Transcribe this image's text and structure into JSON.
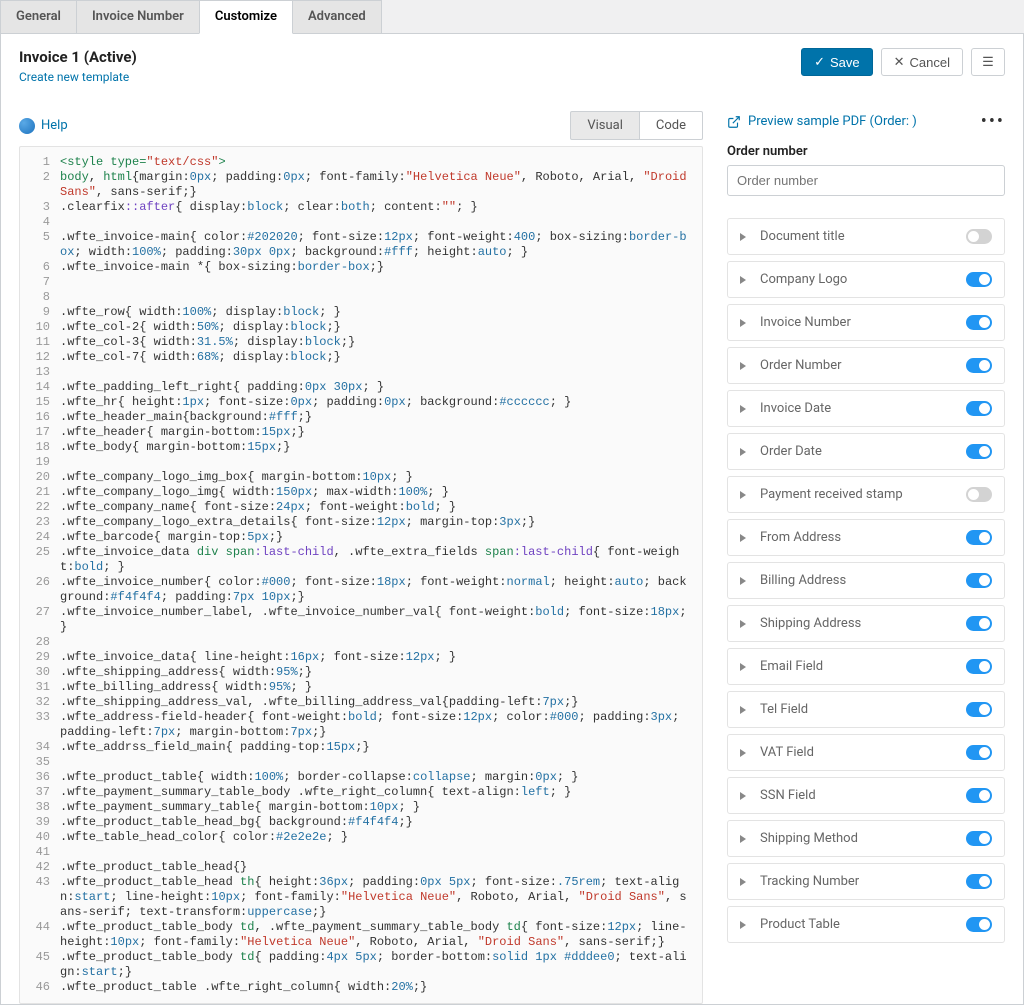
{
  "tabs": {
    "general": "General",
    "invoice_number": "Invoice Number",
    "customize": "Customize",
    "advanced": "Advanced"
  },
  "header": {
    "title": "Invoice 1 (Active)",
    "new_template": "Create new template",
    "save": "Save",
    "cancel": "Cancel"
  },
  "leftbar": {
    "help": "Help",
    "visual": "Visual",
    "code": "Code"
  },
  "preview": {
    "link": "Preview sample PDF (Order: )",
    "order_label": "Order number",
    "order_placeholder": "Order number"
  },
  "accordion": [
    {
      "label": "Document title",
      "on": false
    },
    {
      "label": "Company Logo",
      "on": true
    },
    {
      "label": "Invoice Number",
      "on": true
    },
    {
      "label": "Order Number",
      "on": true
    },
    {
      "label": "Invoice Date",
      "on": true
    },
    {
      "label": "Order Date",
      "on": true
    },
    {
      "label": "Payment received stamp",
      "on": false
    },
    {
      "label": "From Address",
      "on": true
    },
    {
      "label": "Billing Address",
      "on": true
    },
    {
      "label": "Shipping Address",
      "on": true
    },
    {
      "label": "Email Field",
      "on": true
    },
    {
      "label": "Tel Field",
      "on": true
    },
    {
      "label": "VAT Field",
      "on": true
    },
    {
      "label": "SSN Field",
      "on": true
    },
    {
      "label": "Shipping Method",
      "on": true
    },
    {
      "label": "Tracking Number",
      "on": true
    },
    {
      "label": "Product Table",
      "on": true
    }
  ],
  "code_lines": [
    {
      "n": 1,
      "h": "<span class='t-green'>&lt;style type=</span><span class='t-red'>\"text/css\"</span><span class='t-green'>&gt;</span>"
    },
    {
      "n": 2,
      "h": "<span class='t-green'>body</span>, <span class='t-green'>html</span>{margin:<span class='t-blue'>0px</span>; padding:<span class='t-blue'>0px</span>; font-family:<span class='t-red'>\"Helvetica Neue\"</span>, Roboto, Arial, <span class='t-red'>\"Droid Sans\"</span>, sans-serif;}"
    },
    {
      "n": 3,
      "h": ".clearfix<span class='t-purple'>::after</span>{ display:<span class='t-blue'>block</span>; clear:<span class='t-blue'>both</span>; content:<span class='t-red'>\"\"</span>; }"
    },
    {
      "n": 4,
      "h": ""
    },
    {
      "n": 5,
      "h": ".wfte_invoice-main{ color:<span class='t-blue'>#202020</span>; font-size:<span class='t-blue'>12px</span>; font-weight:<span class='t-blue'>400</span>; box-sizing:<span class='t-blue'>border-box</span>; width:<span class='t-blue'>100%</span>; padding:<span class='t-blue'>30px 0px</span>; background:<span class='t-blue'>#fff</span>; height:<span class='t-blue'>auto</span>; }"
    },
    {
      "n": 6,
      "h": ".wfte_invoice-main *{ box-sizing:<span class='t-blue'>border-box</span>;}"
    },
    {
      "n": 7,
      "h": ""
    },
    {
      "n": 8,
      "h": ""
    },
    {
      "n": 9,
      "h": ".wfte_row{ width:<span class='t-blue'>100%</span>; display:<span class='t-blue'>block</span>; }"
    },
    {
      "n": 10,
      "h": ".wfte_col-2{ width:<span class='t-blue'>50%</span>; display:<span class='t-blue'>block</span>;}"
    },
    {
      "n": 11,
      "h": ".wfte_col-3{ width:<span class='t-blue'>31.5%</span>; display:<span class='t-blue'>block</span>;}"
    },
    {
      "n": 12,
      "h": ".wfte_col-7{ width:<span class='t-blue'>68%</span>; display:<span class='t-blue'>block</span>;}"
    },
    {
      "n": 13,
      "h": ""
    },
    {
      "n": 14,
      "h": ".wfte_padding_left_right{ padding:<span class='t-blue'>0px 30px</span>; }"
    },
    {
      "n": 15,
      "h": ".wfte_hr{ height:<span class='t-blue'>1px</span>; font-size:<span class='t-blue'>0px</span>; padding:<span class='t-blue'>0px</span>; background:<span class='t-blue'>#cccccc</span>; }"
    },
    {
      "n": 16,
      "h": ".wfte_header_main{background:<span class='t-blue'>#fff</span>;}"
    },
    {
      "n": 17,
      "h": ".wfte_header{ margin-bottom:<span class='t-blue'>15px</span>;}"
    },
    {
      "n": 18,
      "h": ".wfte_body{ margin-bottom:<span class='t-blue'>15px</span>;}"
    },
    {
      "n": 19,
      "h": ""
    },
    {
      "n": 20,
      "h": ".wfte_company_logo_img_box{ margin-bottom:<span class='t-blue'>10px</span>; }"
    },
    {
      "n": 21,
      "h": ".wfte_company_logo_img{ width:<span class='t-blue'>150px</span>; max-width:<span class='t-blue'>100%</span>; }"
    },
    {
      "n": 22,
      "h": ".wfte_company_name{ font-size:<span class='t-blue'>24px</span>; font-weight:<span class='t-blue'>bold</span>; }"
    },
    {
      "n": 23,
      "h": ".wfte_company_logo_extra_details{ font-size:<span class='t-blue'>12px</span>; margin-top:<span class='t-blue'>3px</span>;}"
    },
    {
      "n": 24,
      "h": ".wfte_barcode{ margin-top:<span class='t-blue'>5px</span>;}"
    },
    {
      "n": 25,
      "h": ".wfte_invoice_data <span class='t-green'>div span</span><span class='t-purple'>:last-child</span>, .wfte_extra_fields <span class='t-green'>span</span><span class='t-purple'>:last-child</span>{ font-weight:<span class='t-blue'>bold</span>; }"
    },
    {
      "n": 26,
      "h": ".wfte_invoice_number{ color:<span class='t-blue'>#000</span>; font-size:<span class='t-blue'>18px</span>; font-weight:<span class='t-blue'>normal</span>; height:<span class='t-blue'>auto</span>; background:<span class='t-blue'>#f4f4f4</span>; padding:<span class='t-blue'>7px 10px</span>;}"
    },
    {
      "n": 27,
      "h": ".wfte_invoice_number_label, .wfte_invoice_number_val{ font-weight:<span class='t-blue'>bold</span>; font-size:<span class='t-blue'>18px</span>; }"
    },
    {
      "n": 28,
      "h": ""
    },
    {
      "n": 29,
      "h": ".wfte_invoice_data{ line-height:<span class='t-blue'>16px</span>; font-size:<span class='t-blue'>12px</span>; }"
    },
    {
      "n": 30,
      "h": ".wfte_shipping_address{ width:<span class='t-blue'>95%</span>;}"
    },
    {
      "n": 31,
      "h": ".wfte_billing_address{ width:<span class='t-blue'>95%</span>; }"
    },
    {
      "n": 32,
      "h": ".wfte_shipping_address_val, .wfte_billing_address_val{padding-left:<span class='t-blue'>7px</span>;}"
    },
    {
      "n": 33,
      "h": ".wfte_address-field-header{ font-weight:<span class='t-blue'>bold</span>; font-size:<span class='t-blue'>12px</span>; color:<span class='t-blue'>#000</span>; padding:<span class='t-blue'>3px</span>; padding-left:<span class='t-blue'>7px</span>; margin-bottom:<span class='t-blue'>7px</span>;}"
    },
    {
      "n": 34,
      "h": ".wfte_addrss_field_main{ padding-top:<span class='t-blue'>15px</span>;}"
    },
    {
      "n": 35,
      "h": ""
    },
    {
      "n": 36,
      "h": ".wfte_product_table{ width:<span class='t-blue'>100%</span>; border-collapse:<span class='t-blue'>collapse</span>; margin:<span class='t-blue'>0px</span>; }"
    },
    {
      "n": 37,
      "h": ".wfte_payment_summary_table_body .wfte_right_column{ text-align:<span class='t-blue'>left</span>; }"
    },
    {
      "n": 38,
      "h": ".wfte_payment_summary_table{ margin-bottom:<span class='t-blue'>10px</span>; }"
    },
    {
      "n": 39,
      "h": ".wfte_product_table_head_bg{ background:<span class='t-blue'>#f4f4f4</span>;}"
    },
    {
      "n": 40,
      "h": ".wfte_table_head_color{ color:<span class='t-blue'>#2e2e2e</span>; }"
    },
    {
      "n": 41,
      "h": ""
    },
    {
      "n": 42,
      "h": ".wfte_product_table_head{}"
    },
    {
      "n": 43,
      "h": ".wfte_product_table_head <span class='t-green'>th</span>{ height:<span class='t-blue'>36px</span>; padding:<span class='t-blue'>0px 5px</span>; font-size:<span class='t-blue'>.75rem</span>; text-align:<span class='t-blue'>start</span>; line-height:<span class='t-blue'>10px</span>; font-family:<span class='t-red'>\"Helvetica Neue\"</span>, Roboto, Arial, <span class='t-red'>\"Droid Sans\"</span>, sans-serif; text-transform:<span class='t-blue'>uppercase</span>;}"
    },
    {
      "n": 44,
      "h": ".wfte_product_table_body <span class='t-green'>td</span>, .wfte_payment_summary_table_body <span class='t-green'>td</span>{ font-size:<span class='t-blue'>12px</span>; line-height:<span class='t-blue'>10px</span>; font-family:<span class='t-red'>\"Helvetica Neue\"</span>, Roboto, Arial, <span class='t-red'>\"Droid Sans\"</span>, sans-serif;}"
    },
    {
      "n": 45,
      "h": ".wfte_product_table_body <span class='t-green'>td</span>{ padding:<span class='t-blue'>4px 5px</span>; border-bottom:<span class='t-blue'>solid 1px #dddee0</span>; text-align:<span class='t-blue'>start</span>;}"
    },
    {
      "n": 46,
      "h": ".wfte_product_table .wfte_right_column{ width:<span class='t-blue'>20%</span>;}"
    }
  ]
}
